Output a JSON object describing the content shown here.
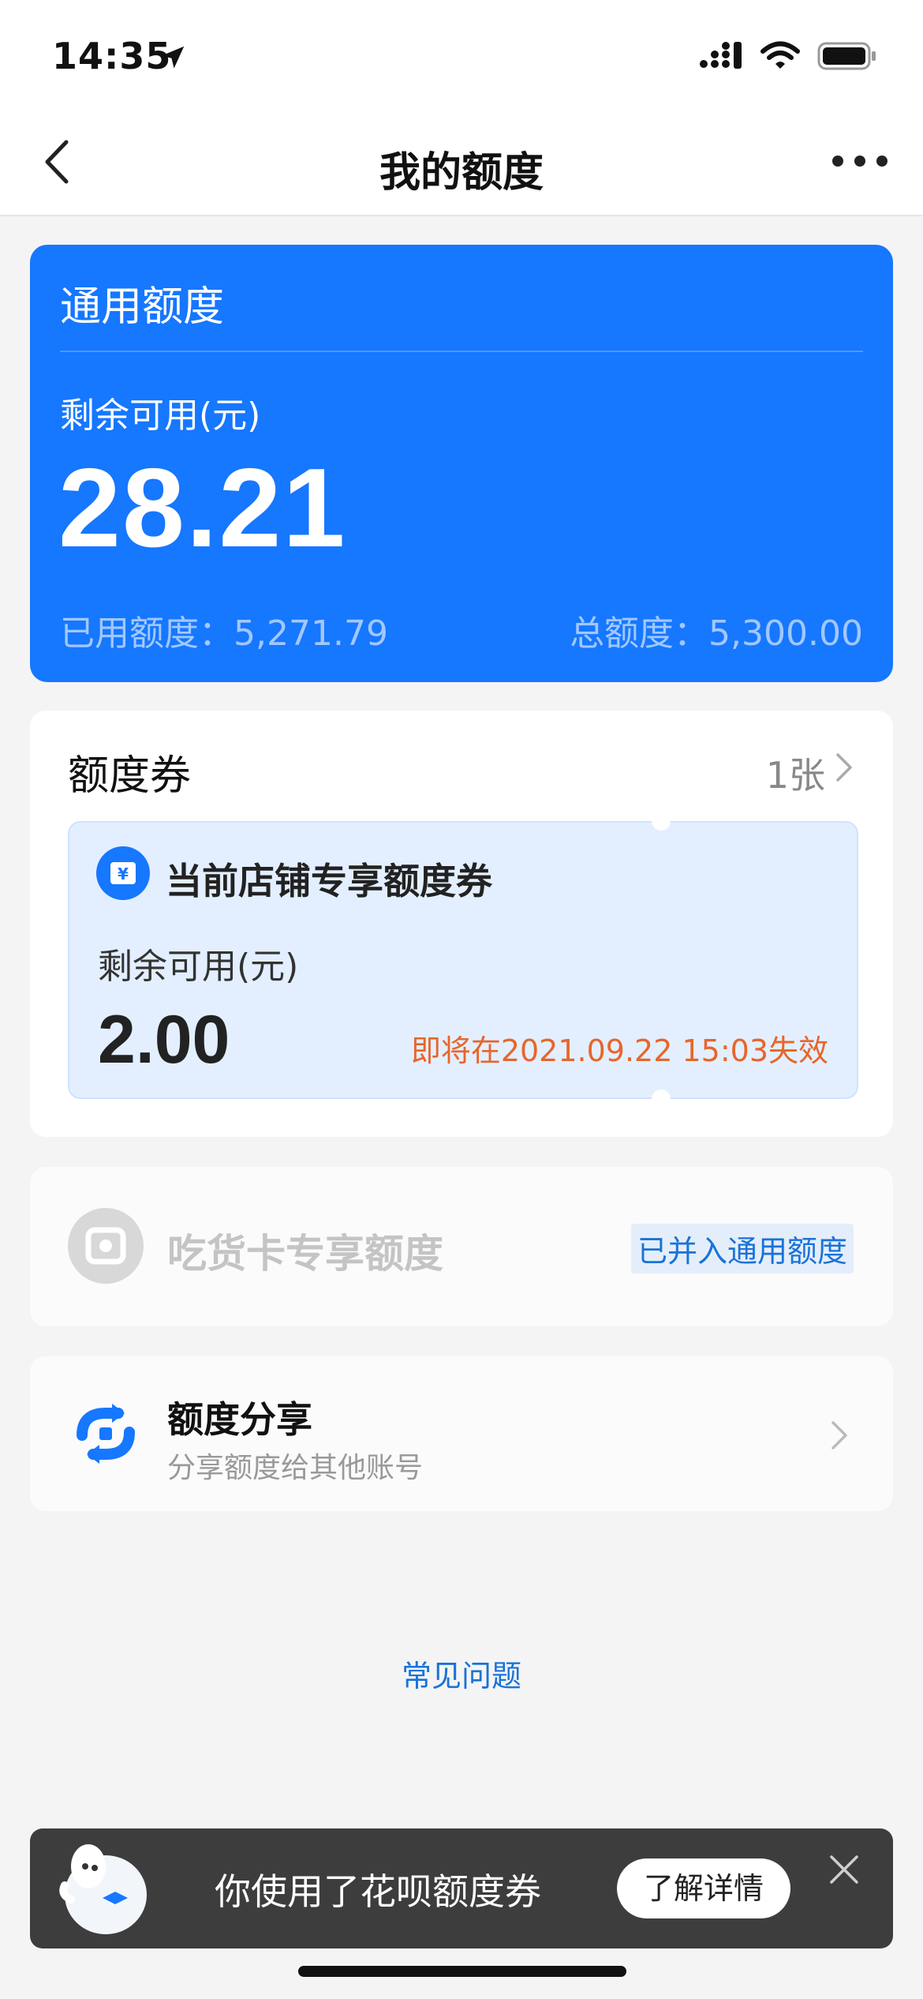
{
  "status_bar": {
    "time": "14:35",
    "icons": [
      "location-arrow-icon",
      "cellular-signal-icon",
      "wifi-icon",
      "battery-icon"
    ]
  },
  "nav": {
    "title": "我的额度",
    "back_icon": "chevron-left-icon",
    "more_icon": "more-dots-icon"
  },
  "general_quota": {
    "title": "通用额度",
    "remaining_label": "剩余可用(元)",
    "remaining_amount": "28.21",
    "used": "已用额度：5,271.79",
    "total": "总额度：5,300.00",
    "color": "#1677ff"
  },
  "coupon_section": {
    "title": "额度券",
    "count": "1张",
    "coupon": {
      "icon": "yen-ticket-icon",
      "name": "当前店铺专享额度券",
      "remaining_label": "剩余可用(元)",
      "amount": "2.00",
      "expire": "即将在2021.09.22 15:03失效"
    }
  },
  "foodie_card": {
    "icon": "foodie-card-icon",
    "name": "吃货卡专享额度",
    "tag": "已并入通用额度"
  },
  "share": {
    "icon": "share-exchange-icon",
    "name": "额度分享",
    "subtitle": "分享额度给其他账号"
  },
  "faq": "常见问题",
  "banner": {
    "mascot_icon": "mascot-icon",
    "text": "你使用了花呗额度券",
    "cta": "了解详情",
    "close_icon": "close-icon"
  }
}
